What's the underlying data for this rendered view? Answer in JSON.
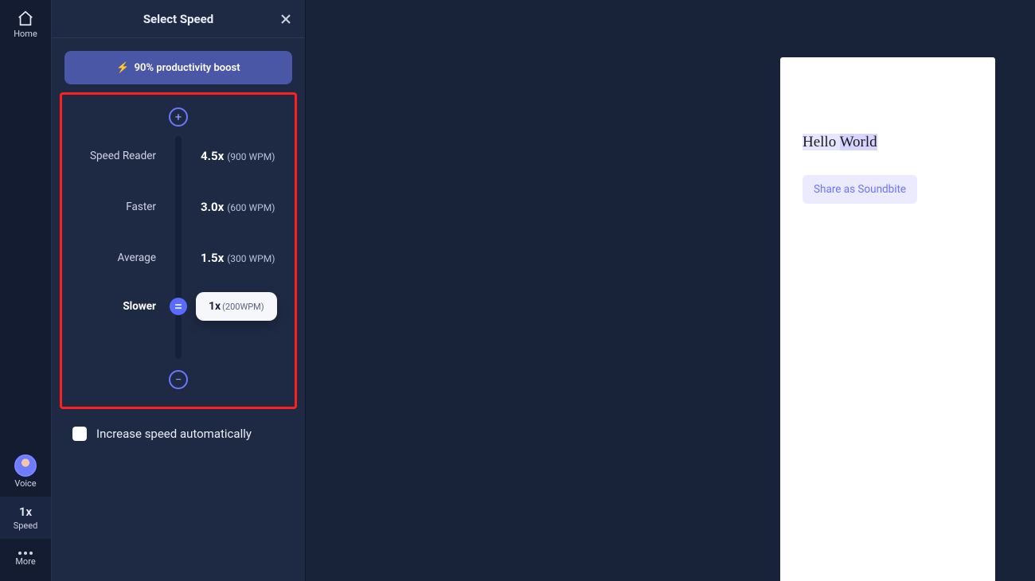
{
  "rail": {
    "home": "Home",
    "voice": "Voice",
    "speed_value": "1x",
    "speed_label": "Speed",
    "more": "More"
  },
  "panel": {
    "title": "Select Speed",
    "boost": "90% productivity boost",
    "rows": [
      {
        "label": "Speed Reader",
        "mult": "4.5x",
        "wpm": "(900 WPM)"
      },
      {
        "label": "Faster",
        "mult": "3.0x",
        "wpm": "(600 WPM)"
      },
      {
        "label": "Average",
        "mult": "1.5x",
        "wpm": "(300 WPM)"
      },
      {
        "label": "Slower",
        "mult": "1x",
        "wpm": "(200WPM)"
      }
    ],
    "tooltip": {
      "mult": "1x",
      "wpm": "(200WPM)"
    },
    "auto": "Increase speed automatically"
  },
  "doc": {
    "word1": "Hello ",
    "word2": "World",
    "share": "Share as Soundbite"
  }
}
